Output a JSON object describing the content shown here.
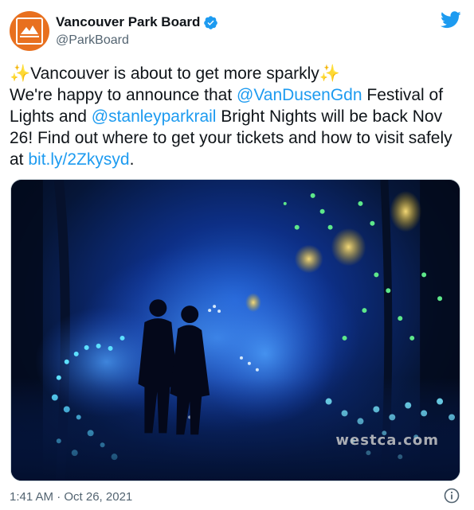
{
  "author": {
    "display_name": "Vancouver Park Board",
    "handle": "@ParkBoard",
    "verified": true,
    "avatar_icon": "park-board-logo"
  },
  "tweet": {
    "sparkle_emoji": "✨",
    "line1_text": "Vancouver is about to get more sparkly",
    "intro": "We're happy to announce that ",
    "mention1": "@VanDusenGdn",
    "mid1": " Festival of Lights and ",
    "mention2": "@stanleyparkrail",
    "mid2": " Bright Nights will be back Nov 26! Find out where to get your tickets and how to visit safely at ",
    "link": "bit.ly/2Zkysyd",
    "end": "."
  },
  "media": {
    "watermark": "westca.com"
  },
  "footer": {
    "timestamp": "1:41 AM · Oct 26, 2021"
  },
  "icons": {
    "brand": "twitter-bird-icon",
    "verified": "verified-badge-icon",
    "info": "info-icon"
  },
  "colors": {
    "link": "#1d9bf0",
    "brand": "#1d9bf0",
    "avatar_bg": "#e8701f",
    "secondary_text": "#536471"
  }
}
